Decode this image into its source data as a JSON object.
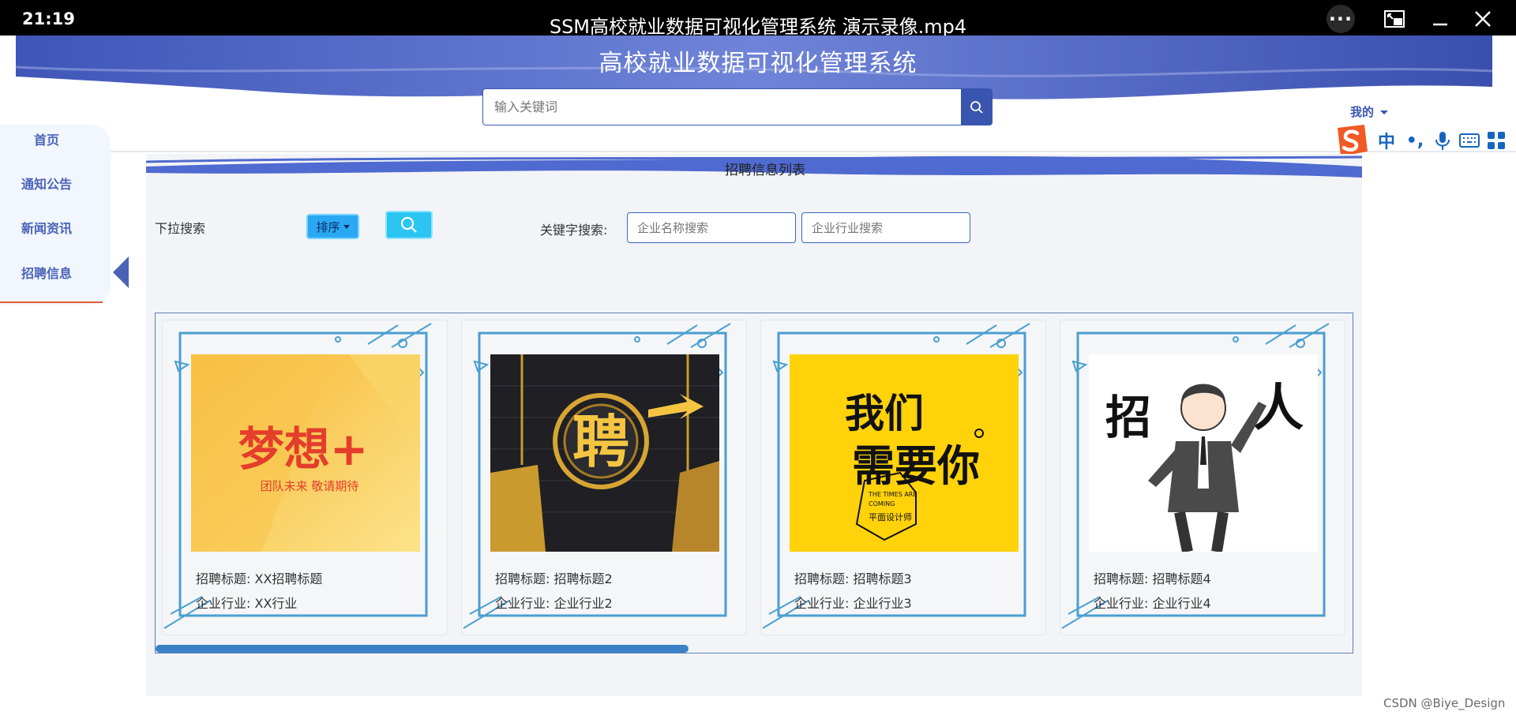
{
  "player": {
    "time": "21:19",
    "title": "SSM高校就业数据可视化管理系统 演示录像.mp4",
    "more_label": "···"
  },
  "header": {
    "site_title": "高校就业数据可视化管理系统",
    "search_placeholder": "输入关键词",
    "user_menu": "我的"
  },
  "ime": {
    "lang": "中",
    "punct": "•,"
  },
  "sidebar": {
    "items": [
      {
        "label": "首页"
      },
      {
        "label": "通知公告"
      },
      {
        "label": "新闻资讯"
      },
      {
        "label": "招聘信息"
      }
    ],
    "active": "招聘信息"
  },
  "main": {
    "list_title": "招聘信息列表",
    "filter_label": "下拉搜索",
    "sort_label": "排序",
    "keyword_label": "关键字搜索:",
    "company_placeholder": "企业名称搜索",
    "industry_placeholder": "企业行业搜索"
  },
  "cards": [
    {
      "title": "招聘标题: XX招聘标题",
      "industry": "企业行业: XX行业",
      "image_text": "梦想+",
      "image_sub": "团队未来 敬请期待"
    },
    {
      "title": "招聘标题: 招聘标题2",
      "industry": "企业行业: 企业行业2",
      "image_text": "聘"
    },
    {
      "title": "招聘标题: 招聘标题3",
      "industry": "企业行业: 企业行业3",
      "image_text_1": "我们",
      "image_text_2": "需要你",
      "image_sub_1": "THE TIMES ARE",
      "image_sub_2": "COMING",
      "image_sub_3": "平面设计师"
    },
    {
      "title": "招聘标题: 招聘标题4",
      "industry": "企业行业: 企业行业4",
      "image_text_1": "招",
      "image_text_2": "人"
    }
  ],
  "watermark": "CSDN @Biye_Design",
  "colors": {
    "primary": "#3a55b0",
    "accent": "#2aa8f2",
    "frame": "#4a9fd0"
  }
}
